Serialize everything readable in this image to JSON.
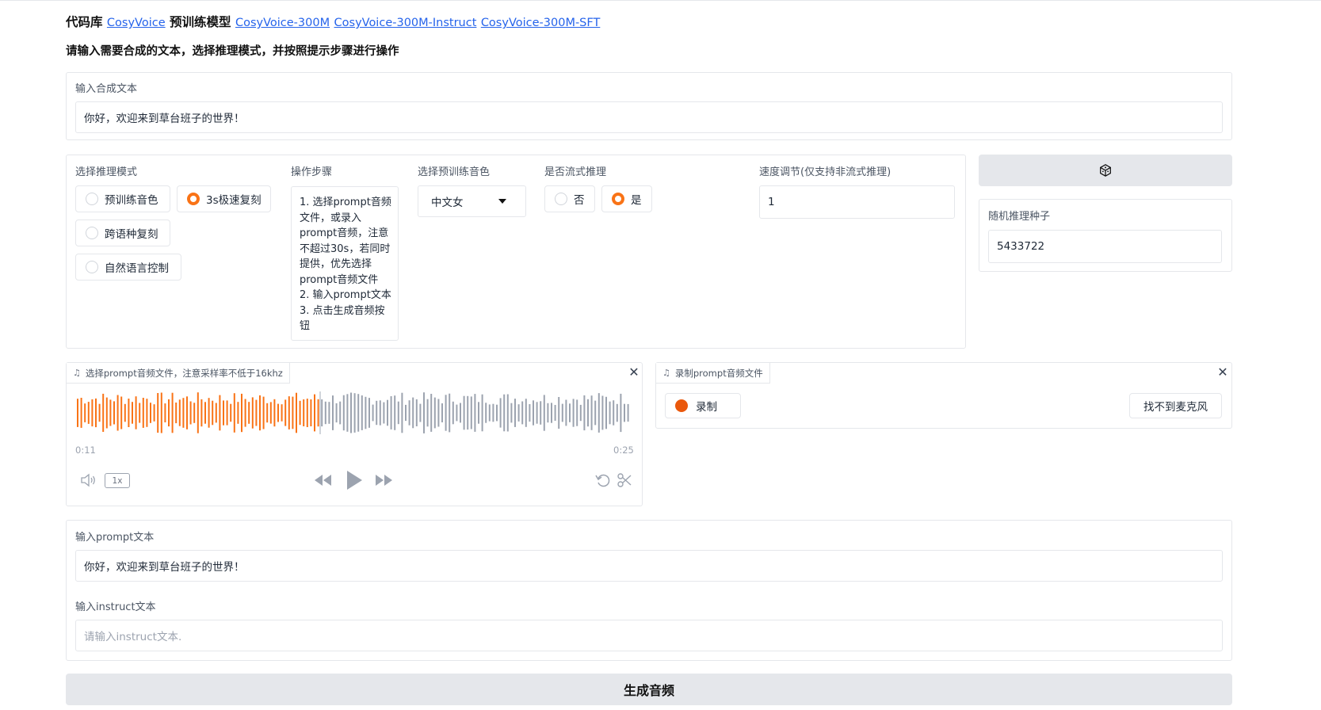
{
  "header": {
    "prefix": "代码库",
    "repo_link": "CosyVoice",
    "models_label": "预训练模型",
    "model_links": [
      "CosyVoice-300M",
      "CosyVoice-300M-Instruct",
      "CosyVoice-300M-SFT"
    ],
    "instruction": "请输入需要合成的文本，选择推理模式，并按照提示步骤进行操作"
  },
  "tts_text": {
    "label": "输入合成文本",
    "value": "你好，欢迎来到草台班子的世界！"
  },
  "mode": {
    "label": "选择推理模式",
    "options": [
      "预训练音色",
      "3s极速复刻",
      "跨语种复刻",
      "自然语言控制"
    ],
    "selected": "3s极速复刻"
  },
  "steps": {
    "label": "操作步骤",
    "lines": [
      "1. 选择prompt音频文件，或录入prompt音频，注意不超过30s，若同时提供，优先选择prompt音频文件",
      "2. 输入prompt文本",
      "3. 点击生成音频按钮"
    ]
  },
  "speaker": {
    "label": "选择预训练音色",
    "value": "中文女"
  },
  "stream": {
    "label": "是否流式推理",
    "options": [
      "否",
      "是"
    ],
    "selected": "是"
  },
  "speed": {
    "label": "速度调节(仅支持非流式推理)",
    "value": "1"
  },
  "seed": {
    "dice_icon": "dice-icon",
    "label": "随机推理种子",
    "value": "5433722"
  },
  "prompt_file": {
    "label": "选择prompt音频文件，注意采样率不低于16khz",
    "current_time": "0:11",
    "duration": "0:25",
    "progress": 0.44,
    "playback_rate": "1x",
    "played_color": "#f97316",
    "unplayed_color": "#9ca3af"
  },
  "record": {
    "label": "录制prompt音频文件",
    "record_button": "录制",
    "mic_button": "找不到麦克风"
  },
  "prompt_text": {
    "label": "输入prompt文本",
    "value": "你好，欢迎来到草台班子的世界！"
  },
  "instruct_text": {
    "label": "输入instruct文本",
    "placeholder": "请输入instruct文本."
  },
  "generate_button": "生成音频"
}
